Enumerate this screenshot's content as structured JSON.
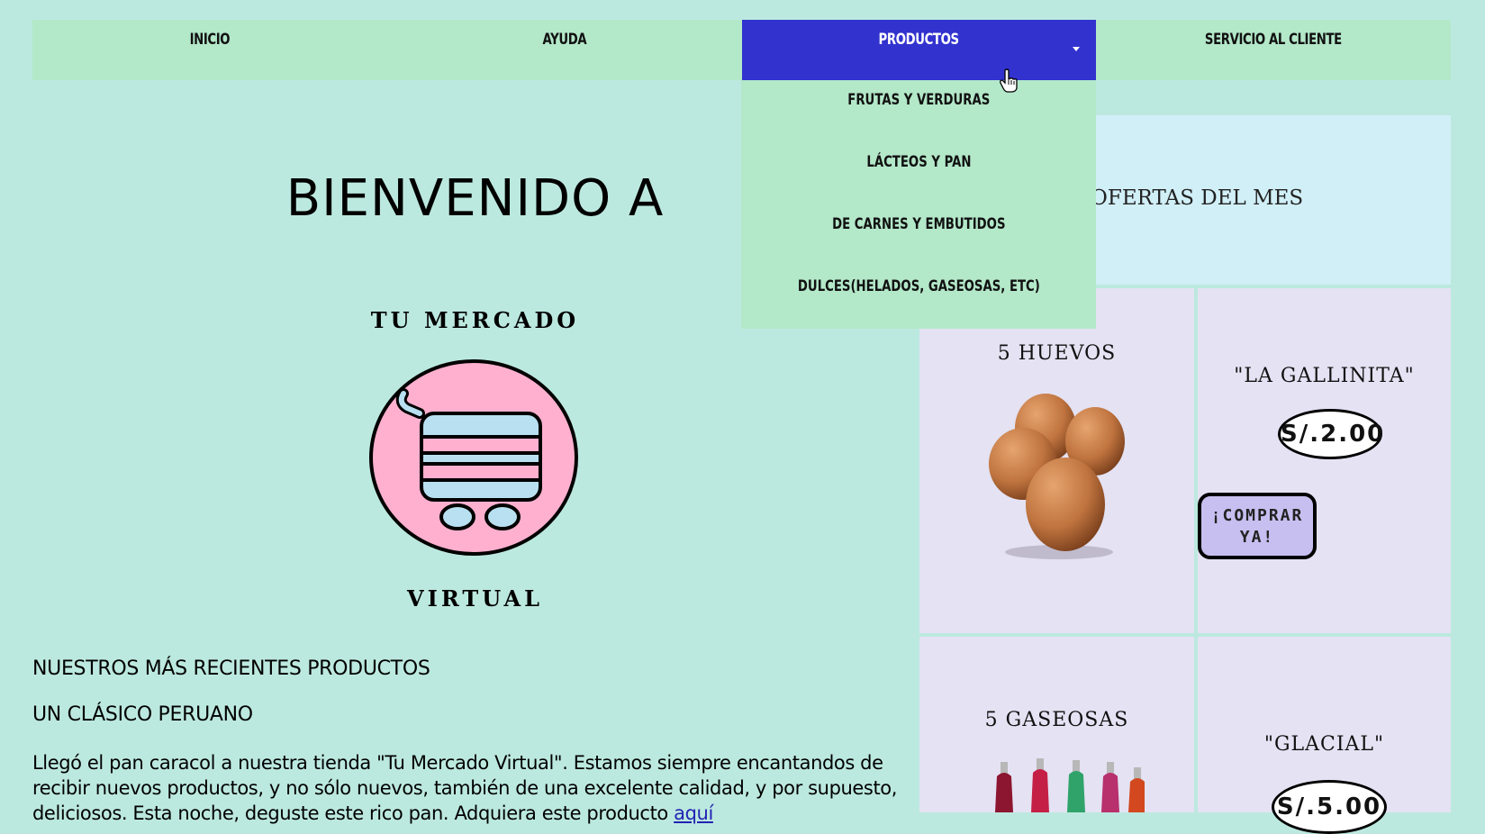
{
  "nav": {
    "items": [
      "INICIO",
      "AYUDA",
      "PRODUCTOS",
      "SERVICIO AL CLIENTE"
    ],
    "active": "PRODUCTOS"
  },
  "dropdown": {
    "items": [
      "FRUTAS Y VERDURAS",
      "LÁCTEOS Y PAN",
      "DE CARNES Y EMBUTIDOS",
      "DULCES(HELADOS, GASEOSAS, ETC)"
    ]
  },
  "hero": {
    "welcome": "BIENVENIDO A",
    "brand_top": "TU MERCADO",
    "brand_bottom": "VIRTUAL"
  },
  "content": {
    "section1": "NUESTROS MÁS RECIENTES PRODUCTOS",
    "section2": "UN CLÁSICO PERUANO",
    "paragraph": "Llegó el pan caracol a nuestra tienda \"Tu Mercado Virtual\". Estamos siempre encantandos de recibir nuevos productos, y no sólo nuevos, también de una excelente calidad, y por supuesto, deliciosos. Esta noche, deguste este rico pan. Adquiera este producto ",
    "link": "aquí"
  },
  "offers": {
    "title": "OFERTAS DEL MES",
    "product1_name": "5 HUEVOS",
    "product1_brand": "\"LA GALLINITA\"",
    "product1_price": "S/.2.00",
    "buy_label": "¡COMPRAR YA!",
    "product2_name": "5 GASEOSAS",
    "product2_brand": "\"GLACIAL\"",
    "product2_price": "S/.5.00"
  },
  "colors": {
    "page_bg": "#bce9df",
    "nav_bg": "#b3e8c9",
    "nav_active": "#3232cf",
    "offers_head_bg": "#d1eff7",
    "offer_cell_bg": "#e4e2f3",
    "logo_pink": "#ffb0cf",
    "logo_blue": "#b8e0f0",
    "buy_button": "#c7bff0"
  }
}
